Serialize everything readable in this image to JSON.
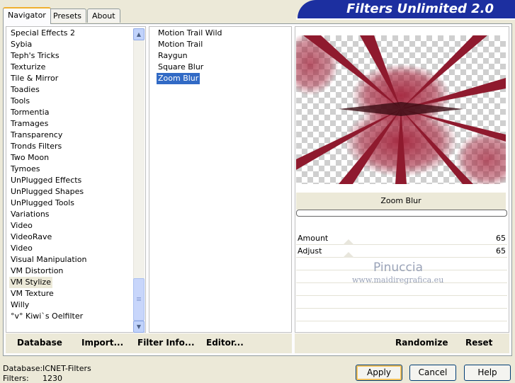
{
  "tabs": [
    {
      "label": "Navigator",
      "active": true
    },
    {
      "label": "Presets",
      "active": false
    },
    {
      "label": "About",
      "active": false
    }
  ],
  "banner": {
    "title": "Filters Unlimited 2.0"
  },
  "categories": [
    "Special Effects 2",
    "Sybia",
    "Teph's Tricks",
    "Texturize",
    "Tile & Mirror",
    "Toadies",
    "Tools",
    "Tormentia",
    "Tramages",
    "Transparency",
    "Tronds Filters",
    "Two Moon",
    "Tymoes",
    "UnPlugged Effects",
    "UnPlugged Shapes",
    "UnPlugged Tools",
    "Variations",
    "Video",
    "VideoRave",
    "Video",
    "Visual Manipulation",
    "VM Distortion",
    "VM Stylize",
    "VM Texture",
    "Willy",
    "°v° Kiwi`s Oelfilter"
  ],
  "selected_category": "VM Stylize",
  "filters": [
    "Motion Trail Wild",
    "Motion Trail",
    "Raygun",
    "Square Blur",
    "Zoom Blur"
  ],
  "selected_filter": "Zoom Blur",
  "preview": {
    "filter_name": "Zoom Blur",
    "accent_color": "#a3223a"
  },
  "settings": [
    {
      "label": "Amount",
      "value": "65"
    },
    {
      "label": "Adjust",
      "value": "65"
    }
  ],
  "watermark": {
    "line1": "Pinuccia",
    "line2": "www.maidiregrafica.eu"
  },
  "left_buttons": {
    "database": "Database",
    "import": "Import...",
    "filter_info": "Filter Info...",
    "editor": "Editor..."
  },
  "right_buttons": {
    "randomize": "Randomize",
    "reset": "Reset"
  },
  "status": {
    "database_label": "Database:",
    "database_value": "ICNET-Filters",
    "filters_label": "Filters:",
    "filters_value": "1230"
  },
  "dialog_buttons": {
    "apply": "Apply",
    "cancel": "Cancel",
    "help": "Help"
  }
}
